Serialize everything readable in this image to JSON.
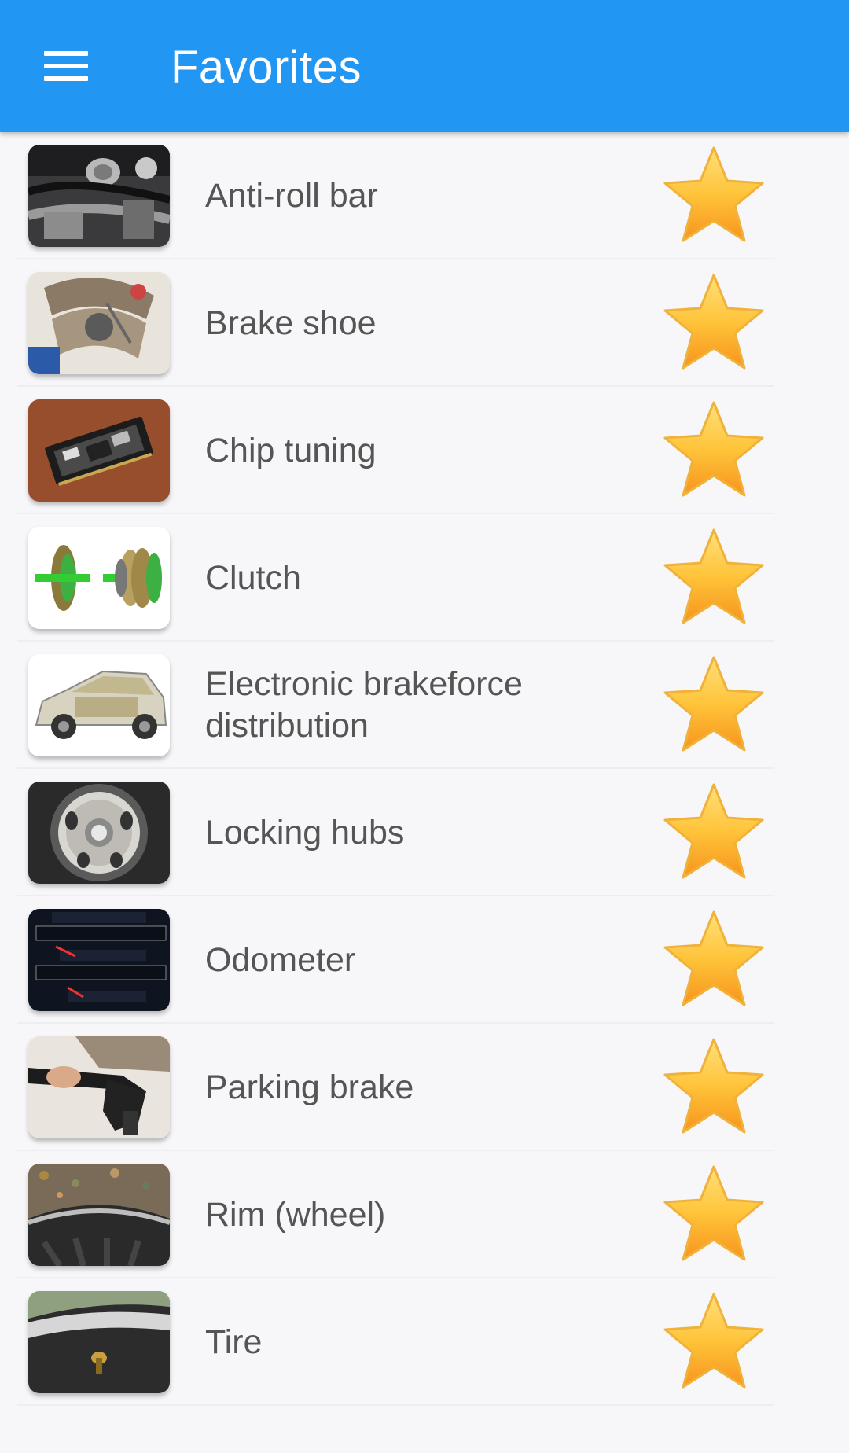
{
  "appbar": {
    "title": "Favorites",
    "menu_icon": "hamburger-menu-icon",
    "color": "#2196f3"
  },
  "favorites": [
    {
      "label": "Anti-roll bar",
      "thumbnail": "anti-roll-bar-photo",
      "favorite": true
    },
    {
      "label": "Brake shoe",
      "thumbnail": "brake-shoe-photo",
      "favorite": true
    },
    {
      "label": "Chip tuning",
      "thumbnail": "chip-tuning-photo",
      "favorite": true
    },
    {
      "label": "Clutch",
      "thumbnail": "clutch-photo",
      "favorite": true
    },
    {
      "label": "Electronic brakeforce distribution",
      "thumbnail": "electronic-brakeforce-distribution-photo",
      "favorite": true
    },
    {
      "label": "Locking hubs",
      "thumbnail": "locking-hubs-photo",
      "favorite": true
    },
    {
      "label": "Odometer",
      "thumbnail": "odometer-photo",
      "favorite": true
    },
    {
      "label": "Parking brake",
      "thumbnail": "parking-brake-photo",
      "favorite": true
    },
    {
      "label": "Rim (wheel)",
      "thumbnail": "rim-wheel-photo",
      "favorite": true
    },
    {
      "label": "Tire",
      "thumbnail": "tire-photo",
      "favorite": true
    }
  ],
  "colors": {
    "star_fill_top": "#ffd24a",
    "star_fill_bottom": "#f79a1e",
    "label_text": "#555555"
  }
}
